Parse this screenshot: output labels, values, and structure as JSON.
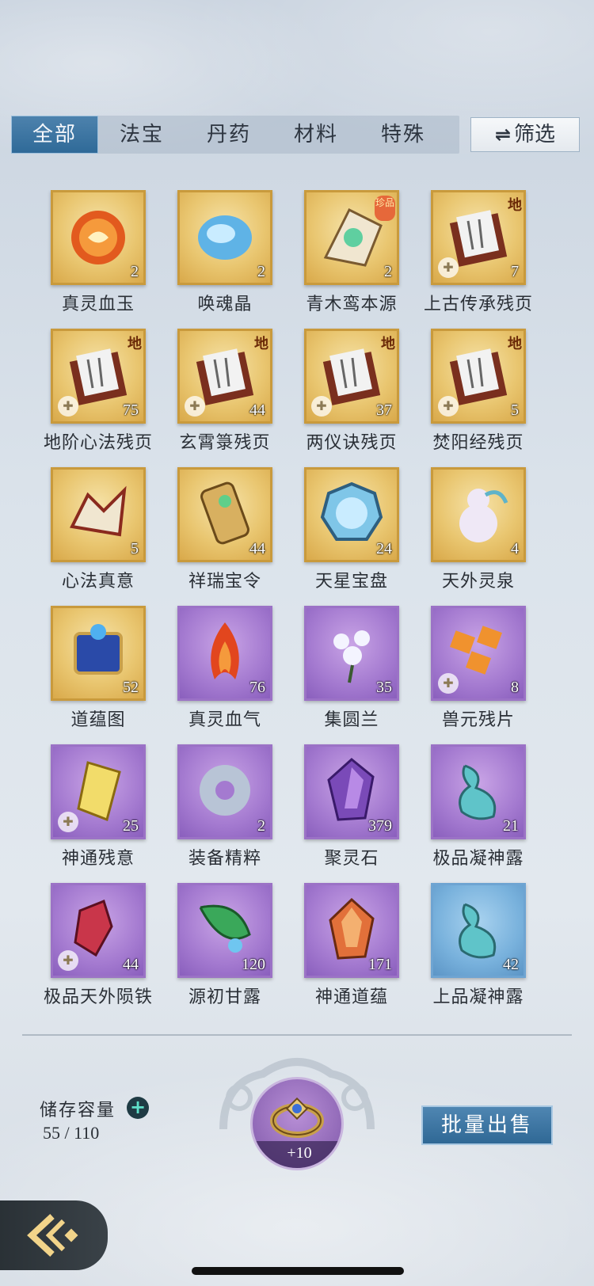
{
  "tabs": [
    {
      "label": "全部",
      "active": true
    },
    {
      "label": "法宝",
      "active": false
    },
    {
      "label": "丹药",
      "active": false
    },
    {
      "label": "材料",
      "active": false
    },
    {
      "label": "特殊",
      "active": false
    }
  ],
  "filter": {
    "icon": "⇌",
    "label": "筛选"
  },
  "items": [
    {
      "name": "真灵血玉",
      "count": "2",
      "rarity": "gold",
      "icon": "red-jade-icon"
    },
    {
      "name": "唤魂晶",
      "count": "2",
      "rarity": "gold",
      "icon": "soul-crystal-icon"
    },
    {
      "name": "青木鸾本源",
      "count": "2",
      "rarity": "gold",
      "icon": "phoenix-origin-icon",
      "badge": "珍品"
    },
    {
      "name": "上古传承残页",
      "count": "7",
      "rarity": "gold",
      "icon": "scroll-page-icon",
      "grade": "地",
      "fragment": true
    },
    {
      "name": "地阶心法残页",
      "count": "75",
      "rarity": "gold",
      "icon": "scroll-page-icon",
      "grade": "地",
      "fragment": true
    },
    {
      "name": "玄霄箓残页",
      "count": "44",
      "rarity": "gold",
      "icon": "scroll-page-icon",
      "grade": "地",
      "fragment": true
    },
    {
      "name": "两仪诀残页",
      "count": "37",
      "rarity": "gold",
      "icon": "scroll-page-icon",
      "grade": "地",
      "fragment": true
    },
    {
      "name": "焚阳经残页",
      "count": "5",
      "rarity": "gold",
      "icon": "scroll-page-icon",
      "grade": "地",
      "fragment": true
    },
    {
      "name": "心法真意",
      "count": "5",
      "rarity": "gold",
      "icon": "broken-seal-icon"
    },
    {
      "name": "祥瑞宝令",
      "count": "44",
      "rarity": "gold",
      "icon": "token-icon"
    },
    {
      "name": "天星宝盘",
      "count": "24",
      "rarity": "gold",
      "icon": "star-disc-icon"
    },
    {
      "name": "天外灵泉",
      "count": "4",
      "rarity": "gold",
      "icon": "gourd-icon"
    },
    {
      "name": "道蕴图",
      "count": "52",
      "rarity": "gold",
      "icon": "dao-map-icon"
    },
    {
      "name": "真灵血气",
      "count": "76",
      "rarity": "purple",
      "icon": "blood-flame-icon"
    },
    {
      "name": "集圆兰",
      "count": "35",
      "rarity": "purple",
      "icon": "orchid-icon"
    },
    {
      "name": "兽元残片",
      "count": "8",
      "rarity": "purple",
      "icon": "beast-shards-icon",
      "fragment": true
    },
    {
      "name": "神通残意",
      "count": "25",
      "rarity": "purple",
      "icon": "talisman-shard-icon",
      "fragment": true
    },
    {
      "name": "装备精粹",
      "count": "2",
      "rarity": "purple",
      "icon": "jade-ring-icon"
    },
    {
      "name": "聚灵石",
      "count": "379",
      "rarity": "purple",
      "icon": "spirit-stone-icon"
    },
    {
      "name": "极品凝神露",
      "count": "21",
      "rarity": "purple",
      "icon": "dew-vase-icon"
    },
    {
      "name": "极品天外陨铁",
      "count": "44",
      "rarity": "purple",
      "icon": "meteor-iron-icon",
      "fragment": true
    },
    {
      "name": "源初甘露",
      "count": "120",
      "rarity": "purple",
      "icon": "leaf-dew-icon"
    },
    {
      "name": "神通道蕴",
      "count": "171",
      "rarity": "purple",
      "icon": "amber-crystal-icon"
    },
    {
      "name": "上品凝神露",
      "count": "42",
      "rarity": "blue",
      "icon": "dew-vase-icon"
    }
  ],
  "storage": {
    "label": "储存容量",
    "value": "55 / 110"
  },
  "ring": {
    "bonus": "+10"
  },
  "sell_button": {
    "label": "批量出售"
  },
  "colors": {
    "gold": "#e9c670",
    "purple": "#a47ad0",
    "blue": "#78b1dc",
    "tab_active": "#2f6a98"
  }
}
